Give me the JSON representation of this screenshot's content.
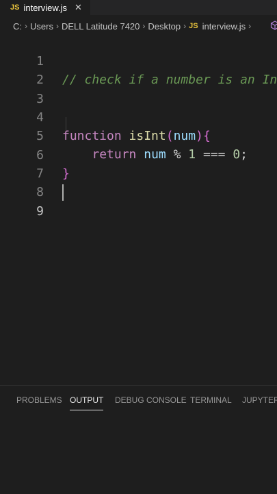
{
  "tab": {
    "badge": "JS",
    "title": "interview.js",
    "close": "✕"
  },
  "breadcrumb": {
    "items": [
      "C:",
      "Users",
      "DELL Latitude 7420",
      "Desktop",
      "interview.js"
    ],
    "file_badge": "JS",
    "separator": "›"
  },
  "editor": {
    "line_numbers": [
      "1",
      "2",
      "3",
      "4",
      "5",
      "6",
      "7",
      "8",
      "9"
    ],
    "active_line": "9",
    "code": {
      "line1_comment": "// check if a number is an In",
      "line4_keyword": "function",
      "line4_name": "isInt",
      "line4_open_paren": "(",
      "line4_param": "num",
      "line4_close_paren": ")",
      "line4_brace": "{",
      "line5_keyword": "return",
      "line5_var": "num",
      "line5_op1": "%",
      "line5_num1": "1",
      "line5_op2": "===",
      "line5_num2": "0",
      "line5_semicolon": ";",
      "line6_brace": "}"
    }
  },
  "panel": {
    "tabs": [
      "PROBLEMS",
      "OUTPUT",
      "DEBUG CONSOLE",
      "TERMINAL",
      "JUPYTER"
    ],
    "active_tab": "OUTPUT"
  },
  "colors": {
    "background": "#1e1e1e",
    "js_badge": "#e8c33c",
    "comment": "#6a9955",
    "keyword": "#c586c0",
    "function_name": "#dcdcaa",
    "number": "#b5cea8",
    "variable": "#9cdcfe"
  }
}
